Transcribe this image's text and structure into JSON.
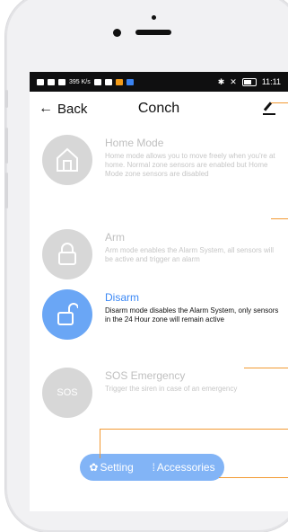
{
  "status_bar": {
    "left_text": "395 K/s",
    "time": "11:11"
  },
  "nav": {
    "back_label": "Back",
    "title": "Conch"
  },
  "modes": [
    {
      "title": "Home Mode",
      "description": "Home mode allows you to move freely when you're at home. Normal zone sensors are enabled but Home Mode zone sensors are disabled",
      "icon": "home-icon",
      "active": false
    },
    {
      "title": "Arm",
      "description": "Arm mode enables the Alarm System, all sensors will be active and trigger an alarm",
      "icon": "lock-icon",
      "active": false
    },
    {
      "title": "Disarm",
      "description": "Disarm mode disables the Alarm System, only sensors in the 24 Hour zone will remain active",
      "icon": "unlock-icon",
      "active": true
    },
    {
      "title": "SOS Emergency",
      "description": "Trigger the siren in case of an emergency",
      "icon_text": "SOS",
      "active": false
    }
  ],
  "bottom_bar": {
    "setting_label": "Setting",
    "accessories_label": "Accessories"
  },
  "colors": {
    "accent": "#3b88f5",
    "active_circle": "#6aa6f5",
    "bottom_bar": "#82b4f6",
    "callout": "#f29a33"
  }
}
